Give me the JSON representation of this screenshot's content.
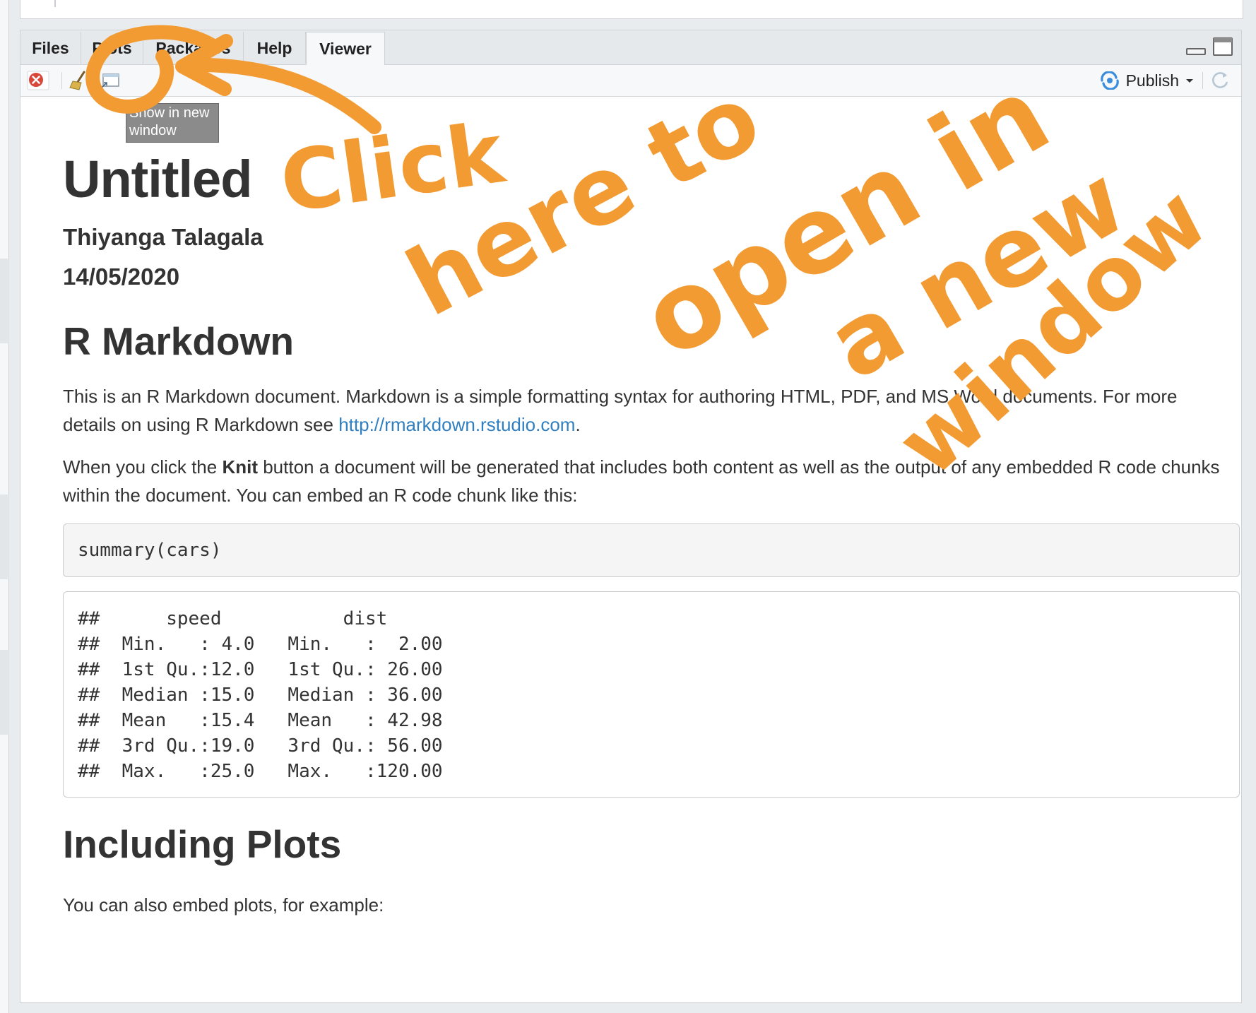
{
  "tabs": [
    {
      "label": "Files"
    },
    {
      "label": "Plots"
    },
    {
      "label": "Packages"
    },
    {
      "label": "Help"
    },
    {
      "label": "Viewer",
      "active": true
    }
  ],
  "toolbar": {
    "publish_label": "Publish",
    "tooltip": "Show in new window"
  },
  "document": {
    "title": "Untitled",
    "author": "Thiyanga Talagala",
    "date": "14/05/2020",
    "section1": "R Markdown",
    "para1_text": "This is an R Markdown document. Markdown is a simple formatting syntax for authoring HTML, PDF, and MS Word documents. For more details on using R Markdown see ",
    "para1_link": "http://rmarkdown.rstudio.com",
    "para1_end": ".",
    "para2_start": "When you click the ",
    "para2_bold": "Knit",
    "para2_end": " button a document will be generated that includes both content as well as the output of any embedded R code chunks within the document. You can embed an R code chunk like this:",
    "code_input": "summary(cars)",
    "code_output": [
      "##      speed           dist       ",
      "##  Min.   : 4.0   Min.   :  2.00  ",
      "##  1st Qu.:12.0   1st Qu.: 26.00  ",
      "##  Median :15.0   Median : 36.00  ",
      "##  Mean   :15.4   Mean   : 42.98  ",
      "##  3rd Qu.:19.0   3rd Qu.: 56.00  ",
      "##  Max.   :25.0   Max.   :120.00  "
    ],
    "section2": "Including Plots",
    "para3": "You can also embed plots, for example:"
  },
  "annotation": {
    "words": [
      "Click",
      "here to",
      "open in",
      "a new",
      "window"
    ],
    "color": "#f39b33"
  },
  "colors": {
    "link": "#2f7fc1",
    "accent": "#f39b33",
    "close_red": "#d9463a",
    "publish_blue": "#3a8ddb"
  }
}
